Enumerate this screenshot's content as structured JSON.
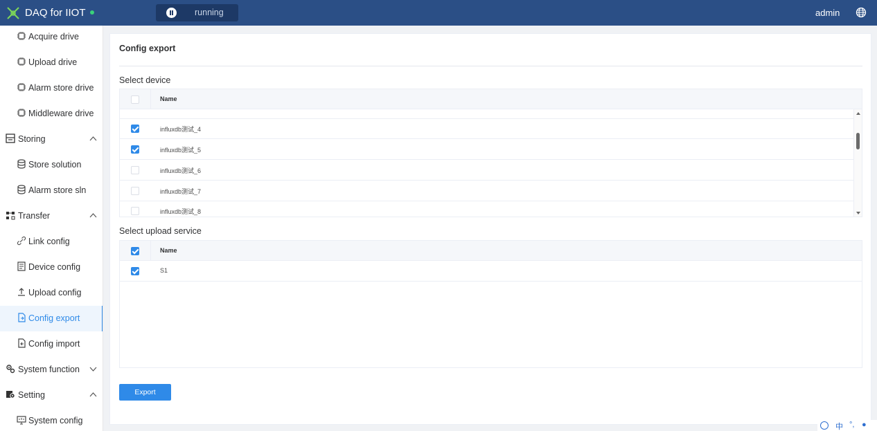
{
  "header": {
    "app_title": "DAQ for IIOT",
    "run_status": "running",
    "user": "admin",
    "icons": {
      "logo": "logo-icon",
      "pause": "pause-icon",
      "globe": "globe-icon"
    },
    "colors": {
      "bar": "#2b4f86",
      "status_dot": "#3ad17a"
    }
  },
  "sidebar": {
    "items": [
      {
        "label": "Acquire drive",
        "icon": "chip-icon"
      },
      {
        "label": "Upload drive",
        "icon": "chip-icon"
      },
      {
        "label": "Alarm store drive",
        "icon": "chip-icon"
      },
      {
        "label": "Middleware drive",
        "icon": "chip-icon"
      },
      {
        "label": "Storing",
        "icon": "storage-icon",
        "group": true,
        "expanded": true
      },
      {
        "label": "Store solution",
        "icon": "database-icon"
      },
      {
        "label": "Alarm store sln",
        "icon": "database-icon"
      },
      {
        "label": "Transfer",
        "icon": "transfer-icon",
        "group": true,
        "expanded": true
      },
      {
        "label": "Link config",
        "icon": "link-icon"
      },
      {
        "label": "Device config",
        "icon": "document-icon"
      },
      {
        "label": "Upload config",
        "icon": "upload-icon"
      },
      {
        "label": "Config export",
        "icon": "file-export-icon",
        "active": true
      },
      {
        "label": "Config import",
        "icon": "file-import-icon"
      },
      {
        "label": "System function",
        "icon": "gears-icon",
        "group": true,
        "expanded": false
      },
      {
        "label": "Setting",
        "icon": "settings-icon",
        "group": true,
        "expanded": true
      },
      {
        "label": "System config",
        "icon": "monitor-icon"
      }
    ]
  },
  "main": {
    "title": "Config export",
    "device_section": {
      "label": "Select device",
      "column": "Name",
      "rows": [
        {
          "name": "influxdb测试_4",
          "checked": true
        },
        {
          "name": "influxdb测试_5",
          "checked": true
        },
        {
          "name": "influxdb测试_6",
          "checked": false
        },
        {
          "name": "influxdb测试_7",
          "checked": false
        },
        {
          "name": "influxdb测试_8",
          "checked": false
        }
      ]
    },
    "upload_section": {
      "label": "Select upload service",
      "column": "Name",
      "rows": [
        {
          "name": "S1",
          "checked": true
        }
      ]
    },
    "export_label": "Export",
    "accent_color": "#2f8ae8"
  },
  "ime_bar": {
    "text": "中"
  }
}
